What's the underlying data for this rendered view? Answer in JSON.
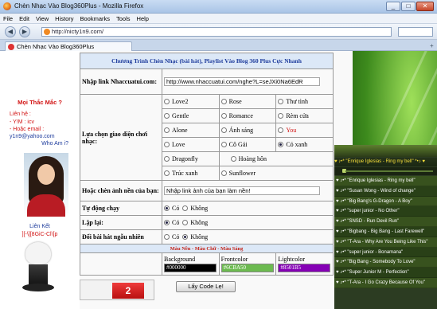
{
  "window": {
    "title": "Chèn Nhạc Vào Blog360Plus - Mozilla Firefox",
    "minimize": "_",
    "maximize": "□",
    "close": "✕"
  },
  "menu": [
    "File",
    "Edit",
    "View",
    "History",
    "Bookmarks",
    "Tools",
    "Help"
  ],
  "nav": {
    "back": "◀",
    "forward": "▶",
    "url": "http://nicty1n9.com/"
  },
  "tab": {
    "title": "Chèn Nhạc Vào Blog360Plus",
    "new": "+"
  },
  "sidebar": {
    "question": "Mọi Thắc Mắc ?",
    "contact_label": "Liên hệ :",
    "ym": "- Y!M : icv",
    "email_label": "- Hoặc email :",
    "email": "y1n9@yahoo.com",
    "who": "Who Am i?",
    "links_label": "Liên Kết",
    "club": "][-\\][8GiC-Cl\\[p"
  },
  "form": {
    "header": "Chương Trình Chèn Nhạc (bài hát), Playlist Vào Blog 360 Plus Cực Nhanh",
    "link_label": "Nhập link Nhaccuatui.com:",
    "link_value": "http://www.nhaccuatui.com/nghe?L=seJXi0Na6EdR",
    "ui_label": "Lựa chọn giao diện chơi nhạc:",
    "ui_options": [
      [
        "Love2",
        "Rose",
        "Thư tình"
      ],
      [
        "Gentle",
        "Romance",
        "Rèm cửa"
      ],
      [
        "Alone",
        "Ánh sáng",
        "You"
      ],
      [
        "Love",
        "Cô Gái",
        "Cỏ xanh"
      ],
      [
        "Dragonfly",
        "",
        "Hoàng hôn"
      ],
      [
        "Trúc xanh",
        "",
        "Sunflower"
      ]
    ],
    "ui_selected": "Cỏ xanh",
    "bg_label": "Hoặc chèn ảnh nền của bạn:",
    "bg_value": "Nhập link ảnh của bạn làm nền!",
    "autoplay_label": "Tự động chạy",
    "repeat_label": "Lặp lại:",
    "shuffle_label": "Đổi bài hát ngẫu nhiên",
    "yes": "Có",
    "no": "Không",
    "autoplay": "Có",
    "repeat": "Có",
    "shuffle": "Không",
    "colors_header": "Màu Nền - Màu Chữ - Màu Sáng",
    "background_label": "Background",
    "background_value": "#000000",
    "frontcolor_label": "Frontcolor",
    "frontcolor_value": "#6CBA50",
    "lightcolor_label": "Lightcolor",
    "lightcolor_value": "#8501B5",
    "colors": {
      "background": "#000000",
      "frontcolor": "#6CBA50",
      "lightcolor": "#8501B5"
    },
    "submit": "Lấy Code Lẹ!",
    "counter": "2"
  },
  "player": {
    "now_playing": "♥ ♪•* \"Enrique Iglesias - Ring my bell\" *•♪ ♥",
    "tracks": [
      "♥ ♪•* \"Enrique Iglesias - Ring my bell\"",
      "♥ ♪•* \"Susan Wong - Wind of change\"",
      "♥ ♪•* \"Big Bang's G-Dragon - A Boy\"",
      "♥ ♪•* \"super junior - No Other\"",
      "♥ ♪•* \"SNSD - Run Devil Run\"",
      "♥ ♪•* \"Bigbang - Big Bang - Last Farewell\"",
      "♥ ♪•* \"T-Ara - Why Are You Being Like This\"",
      "♥ ♪•* \"super junior - Bonamana\"",
      "♥ ♪•* \"Big Bang - Somebody To Love\"",
      "♥ ♪•* \"Super Junior M - Perfection\"",
      "♥ ♪•* \"T-Ara - I Go Crazy Because Of You\""
    ]
  }
}
